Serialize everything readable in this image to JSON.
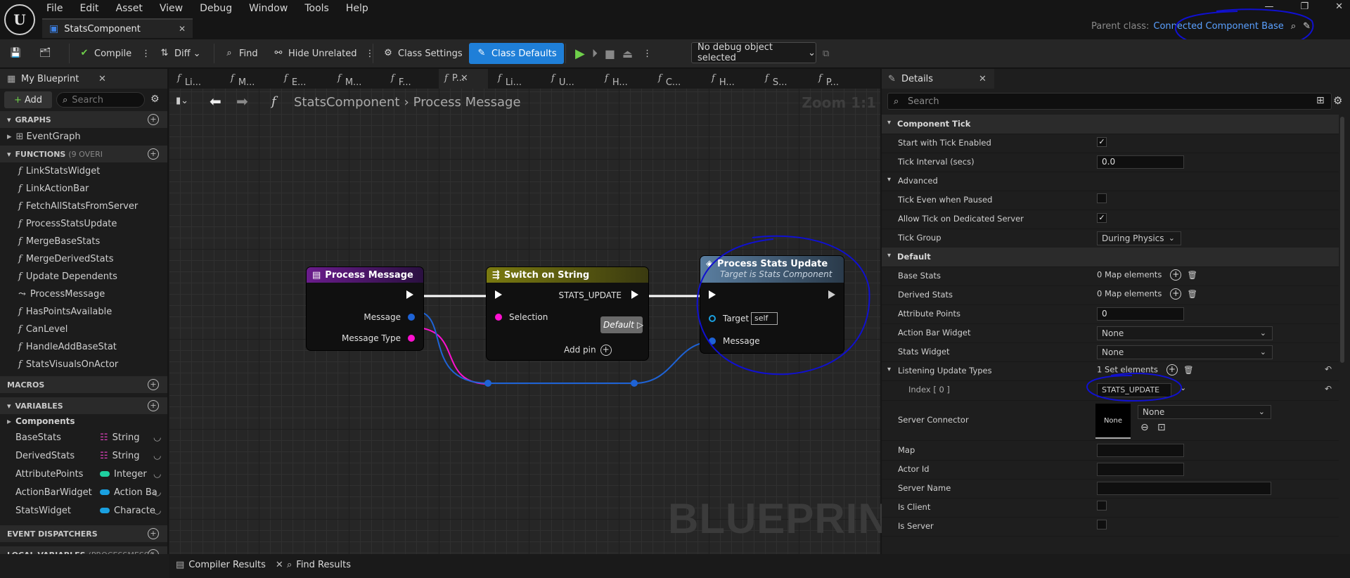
{
  "menu": [
    "File",
    "Edit",
    "Asset",
    "View",
    "Debug",
    "Window",
    "Tools",
    "Help"
  ],
  "doc_tab": {
    "title": "StatsComponent"
  },
  "parent_class": {
    "label": "Parent class:",
    "value": "Connected Component Base"
  },
  "toolbar": {
    "compile": "Compile",
    "diff": "Diff",
    "find": "Find",
    "hide_unrelated": "Hide Unrelated",
    "class_settings": "Class Settings",
    "class_defaults": "Class Defaults",
    "debug_object": "No debug object selected"
  },
  "my_blueprint": {
    "tab": "My Blueprint",
    "add": "Add",
    "search_placeholder": "Search",
    "sections": {
      "graphs": "GRAPHS",
      "functions": "FUNCTIONS",
      "functions_note": "(9 OVERI",
      "macros": "MACROS",
      "variables": "VARIABLES",
      "event_dispatchers": "EVENT DISPATCHERS",
      "local_variables": "LOCAL VARIABLES",
      "local_note": "(PROCESSMESSA"
    },
    "graphs": [
      "EventGraph"
    ],
    "functions": [
      "LinkStatsWidget",
      "LinkActionBar",
      "FetchAllStatsFromServer",
      "ProcessStatsUpdate",
      "MergeBaseStats",
      "MergeDerivedStats",
      "Update Dependents",
      "ProcessMessage",
      "HasPointsAvailable",
      "CanLevel",
      "HandleAddBaseStat",
      "StatsVisualsOnActor"
    ],
    "var_category": "Components",
    "variables": [
      {
        "name": "BaseStats",
        "type": "String",
        "color": "#e040c0"
      },
      {
        "name": "DerivedStats",
        "type": "String",
        "color": "#e040c0"
      },
      {
        "name": "AttributePoints",
        "type": "Integer",
        "color": "#1fd0a0"
      },
      {
        "name": "ActionBarWidget",
        "type": "Action Ba",
        "color": "#1aa0e0"
      },
      {
        "name": "StatsWidget",
        "type": "Characte",
        "color": "#1aa0e0"
      }
    ]
  },
  "graph": {
    "tabs": [
      "Li...",
      "M...",
      "E...",
      "M...",
      "F...",
      "P...",
      "Li...",
      "U...",
      "H...",
      "C...",
      "H...",
      "S...",
      "P..."
    ],
    "breadcrumb_root": "StatsComponent",
    "breadcrumb_leaf": "Process Message",
    "zoom": "Zoom 1:1",
    "watermark": "BLUEPRINT",
    "nodes": {
      "process_message": {
        "title": "Process Message",
        "pins": [
          "Message",
          "Message Type"
        ]
      },
      "switch_on_string": {
        "title": "Switch on String",
        "selection": "Selection",
        "case": "STATS_UPDATE",
        "default": "Default",
        "add_pin": "Add pin"
      },
      "process_stats_update": {
        "title": "Process Stats Update",
        "subtitle": "Target is Stats Component",
        "target": "Target",
        "target_value": "self",
        "message": "Message"
      }
    }
  },
  "details": {
    "tab": "Details",
    "search_placeholder": "Search",
    "rows": {
      "component_tick": "Component Tick",
      "start_tick": "Start with Tick Enabled",
      "tick_interval": "Tick Interval (secs)",
      "tick_interval_val": "0.0",
      "advanced": "Advanced",
      "tick_paused": "Tick Even when Paused",
      "allow_tick": "Allow Tick on Dedicated Server",
      "tick_group": "Tick Group",
      "tick_group_val": "During Physics",
      "default": "Default",
      "base_stats": "Base Stats",
      "base_stats_val": "0 Map elements",
      "derived_stats": "Derived Stats",
      "derived_stats_val": "0 Map elements",
      "attribute_points": "Attribute Points",
      "attribute_points_val": "0",
      "action_bar_widget": "Action Bar Widget",
      "action_bar_val": "None",
      "stats_widget": "Stats Widget",
      "stats_widget_val": "None",
      "listening": "Listening Update Types",
      "listening_val": "1 Set elements",
      "index0": "Index [ 0 ]",
      "index0_val": "STATS_UPDATE",
      "server_connector": "Server Connector",
      "server_connector_thumb": "None",
      "server_connector_val": "None",
      "map": "Map",
      "actor_id": "Actor Id",
      "server_name": "Server Name",
      "is_client": "Is Client",
      "is_server": "Is Server"
    }
  },
  "bottom": {
    "compiler_results": "Compiler Results",
    "find_results": "Find Results"
  },
  "colors": {
    "accent": "#1f7fd8",
    "annotation": "#1010d0"
  }
}
